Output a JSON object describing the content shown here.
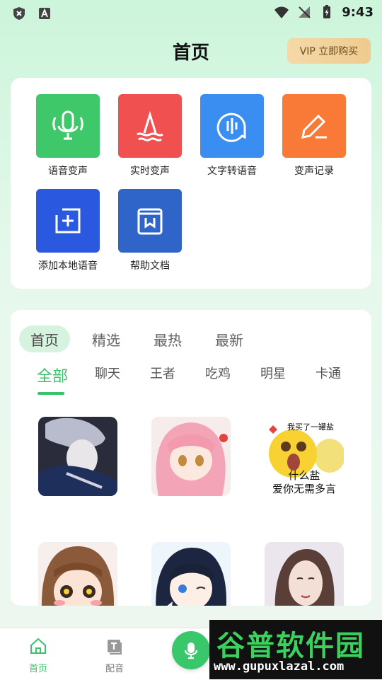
{
  "status_bar": {
    "time": "9:43"
  },
  "header": {
    "title": "首页",
    "vip_label": "VIP 立即购买"
  },
  "tools": [
    {
      "label": "语音变声",
      "color": "#3ec86a",
      "icon": "mic-icon"
    },
    {
      "label": "实时变声",
      "color": "#f05050",
      "icon": "wave-peak-icon"
    },
    {
      "label": "文字转语音",
      "color": "#3a8ef2",
      "icon": "speech-bubble-icon"
    },
    {
      "label": "变声记录",
      "color": "#f97a36",
      "icon": "pen-icon"
    },
    {
      "label": "添加本地语音",
      "color": "#2a59e0",
      "icon": "add-square-icon"
    },
    {
      "label": "帮助文档",
      "color": "#2f64c8",
      "icon": "book-icon"
    }
  ],
  "feed": {
    "tabs": [
      "首页",
      "精选",
      "最热",
      "最新"
    ],
    "categories": [
      "全部",
      "聊天",
      "王者",
      "吃鸡",
      "明星",
      "卡通"
    ],
    "meme_text": {
      "top": "我买了一罐盐",
      "line1": "什么盐",
      "line2": "爱你无需多言"
    }
  },
  "bottom_nav": {
    "home_label": "首页",
    "dub_label": "配音"
  },
  "watermark": {
    "line1": "谷普软件园",
    "line2": "www.gupuxlazal.com"
  }
}
